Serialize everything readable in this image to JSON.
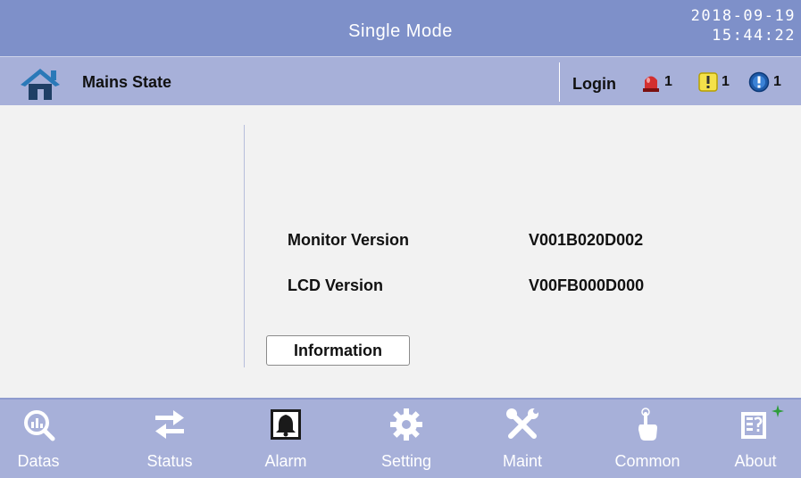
{
  "header": {
    "title": "Single Mode",
    "date": "2018-09-19",
    "time": "15:44:22"
  },
  "status_bar": {
    "home_icon": "home-icon",
    "state": "Mains State",
    "login_label": "Login",
    "alarm_counts": {
      "fault": "1",
      "warning": "1",
      "info": "1"
    }
  },
  "main": {
    "rows": [
      {
        "label": "Monitor Version",
        "value": "V001B020D002"
      },
      {
        "label": "LCD Version",
        "value": "V00FB000D000"
      }
    ],
    "information_button": "Information"
  },
  "nav": {
    "items": [
      {
        "label": "Datas",
        "icon": "data-magnifier-icon"
      },
      {
        "label": "Status",
        "icon": "swap-arrows-icon"
      },
      {
        "label": "Alarm",
        "icon": "bell-icon"
      },
      {
        "label": "Setting",
        "icon": "gear-icon"
      },
      {
        "label": "Maint",
        "icon": "tools-icon"
      },
      {
        "label": "Common",
        "icon": "touch-hand-icon"
      },
      {
        "label": "About",
        "icon": "help-document-icon"
      }
    ]
  },
  "colors": {
    "title_bar": "#7e90c9",
    "status_bar": "#a7b0d9",
    "content_bg": "#f2f2f2",
    "fault": "#d32f2f",
    "warning": "#f4e14a",
    "info": "#1e5aa8",
    "home_roof": "#2a79b8",
    "home_body": "#1f3f66"
  }
}
